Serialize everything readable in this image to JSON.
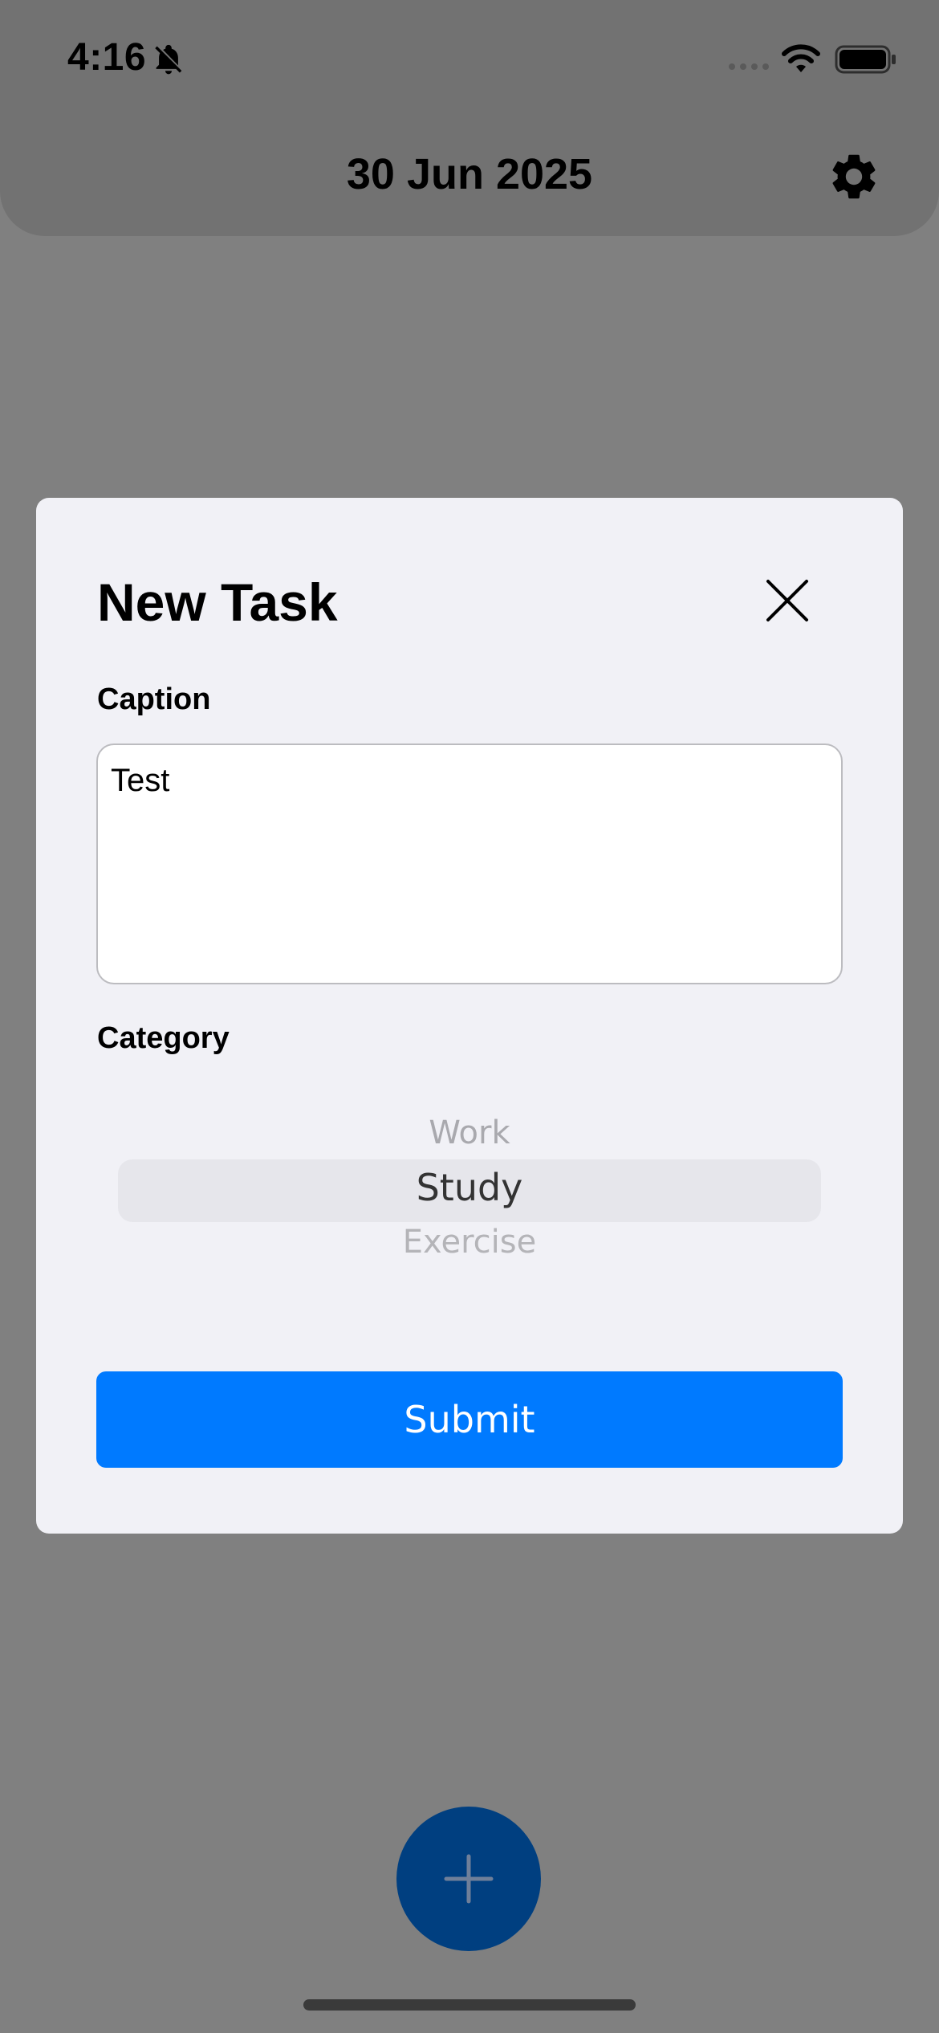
{
  "status_bar": {
    "time": "4:16",
    "icons": [
      "bell-slash-icon",
      "cellular-signal-icon",
      "wifi-icon",
      "battery-icon"
    ]
  },
  "header": {
    "date": "30 Jun 2025",
    "settings_icon": "gear-icon"
  },
  "modal": {
    "title": "New Task",
    "close_icon": "close-icon",
    "caption_label": "Caption",
    "caption_value": "Test",
    "category_label": "Category",
    "category_options": [
      "Work",
      "Study",
      "Exercise"
    ],
    "category_selected": "Study",
    "submit_label": "Submit"
  },
  "fab": {
    "icon": "plus-icon"
  },
  "colors": {
    "accent": "#007aff",
    "overlay": "#808080",
    "fab": "#003f80",
    "modal_bg": "#f1f1f6"
  }
}
